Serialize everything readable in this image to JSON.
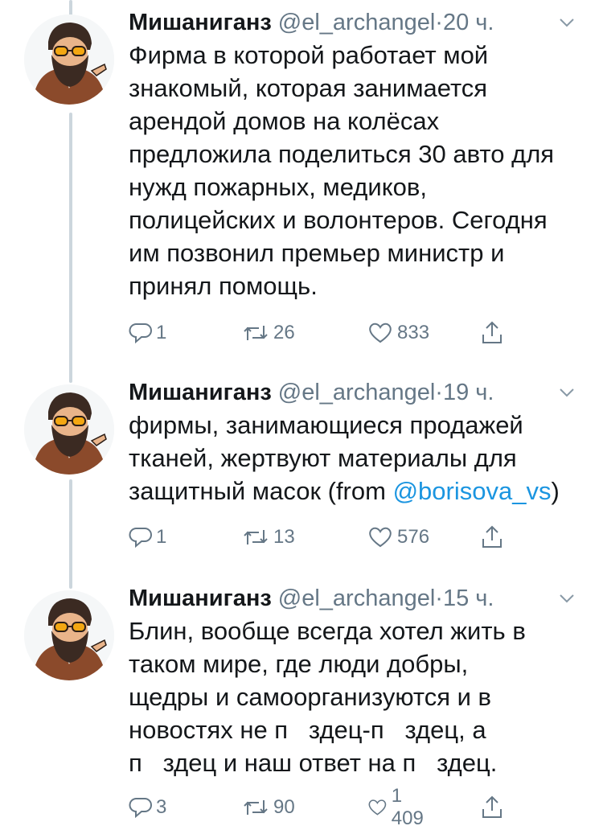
{
  "tweets": [
    {
      "name": "Мишаниганз",
      "handle": "@el_archangel",
      "separator": "·",
      "time": "20 ч.",
      "lines": [
        "Фирма в которой работает мой",
        "знакомый, которая занимается",
        "арендой домов на колёсах",
        "предложила поделиться 30 авто для",
        "нужд пожарных, медиков,",
        "полицейских и волонтеров. Сегодня",
        "им позвонил премьер министр и",
        "принял помощь."
      ],
      "replies": "1",
      "retweets": "26",
      "likes": "833"
    },
    {
      "name": "Мишаниганз",
      "handle": "@el_archangel",
      "separator": "·",
      "time": "19 ч.",
      "lines": [
        "фирмы, занимающиеся продажей",
        "тканей, жертвуют материалы для"
      ],
      "last_line_prefix": "защитный масок (from ",
      "last_line_mention": "@borisova_vs",
      "last_line_suffix": ")",
      "replies": "1",
      "retweets": "13",
      "likes": "576"
    },
    {
      "name": "Мишаниганз",
      "handle": "@el_archangel",
      "separator": "·",
      "time": "15 ч.",
      "lines": [
        "Блин, вообще всегда хотел жить в",
        "таком мире, где люди добры,",
        "щедры и самоорганизуются и в",
        "новостях не п   здец-п   здец, а",
        "п   здец и наш ответ на п   здец."
      ],
      "replies": "3",
      "retweets": "90",
      "likes": "1 409"
    }
  ],
  "icons": {
    "reply": "reply-icon",
    "retweet": "retweet-icon",
    "like": "heart-icon",
    "share": "share-icon",
    "more": "chevron-down-icon",
    "avatar": "bearded-man-avatar"
  },
  "colors": {
    "text": "#14171a",
    "secondary": "#657786",
    "link": "#1b95e0",
    "thread_line": "#ccd6dd"
  }
}
